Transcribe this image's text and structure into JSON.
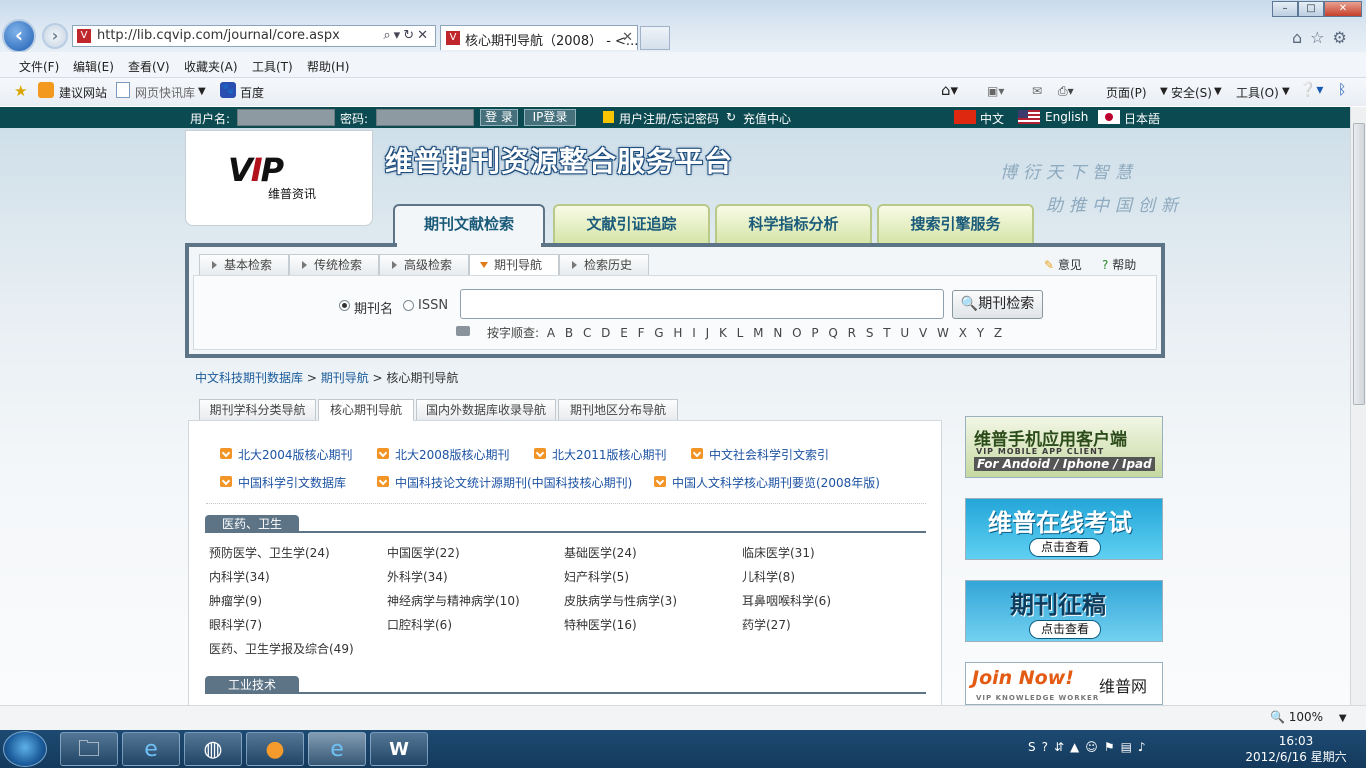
{
  "browser": {
    "url": "http://lib.cqvip.com/journal/core.aspx",
    "tab_title": "核心期刊导航（2008） - <...",
    "menu": [
      "文件(F)",
      "编辑(E)",
      "查看(V)",
      "收藏夹(A)",
      "工具(T)",
      "帮助(H)"
    ],
    "favorites": [
      "建议网站",
      "网页快讯库",
      "百度"
    ],
    "commands": [
      "页面(P)",
      "安全(S)",
      "工具(O)"
    ],
    "zoom": "100%"
  },
  "login": {
    "user_label": "用户名:",
    "pwd_label": "密码:",
    "login_btn": "登 录",
    "ip_btn": "IP登录",
    "register": "用户注册/忘记密码",
    "recharge": "充值中心",
    "lang_cn": "中文",
    "lang_en": "English",
    "lang_jp": "日本語"
  },
  "header": {
    "logo_sub": "维普资讯",
    "site_title": "维普期刊资源整合服务平台",
    "slogan1": "博衍天下智慧",
    "slogan2": "助推中国创新"
  },
  "main_tabs": [
    "期刊文献检索",
    "文献引证追踪",
    "科学指标分析",
    "搜索引擎服务"
  ],
  "search": {
    "subtabs": [
      "基本检索",
      "传统检索",
      "高级检索",
      "期刊导航",
      "检索历史"
    ],
    "opinion": "意见",
    "help": "帮助",
    "radio1": "期刊名",
    "radio2": "ISSN",
    "input_value": "",
    "button": "期刊检索",
    "letters_label": "按字顺查:",
    "letters": "A B C D E F G H I J K L M N O P Q R S T U V W X Y Z"
  },
  "breadcrumb": {
    "a": "中文科技期刊数据库",
    "sep": " > ",
    "b": "期刊导航",
    "cur": "核心期刊导航"
  },
  "list_tabs": [
    "期刊学科分类导航",
    "核心期刊导航",
    "国内外数据库收录导航",
    "期刊地区分布导航"
  ],
  "core_links": [
    "北大2004版核心期刊",
    "北大2008版核心期刊",
    "北大2011版核心期刊",
    "中文社会科学引文索引",
    "中国科学引文数据库",
    "中国科技论文统计源期刊(中国科技核心期刊)",
    "中国人文科学核心期刊要览(2008年版)"
  ],
  "sections": [
    {
      "title": "医药、卫生",
      "items": [
        "预防医学、卫生学(24)",
        "中国医学(22)",
        "基础医学(24)",
        "临床医学(31)",
        "内科学(34)",
        "外科学(34)",
        "妇产科学(5)",
        "儿科学(8)",
        "肿瘤学(9)",
        "神经病学与精神病学(10)",
        "皮肤病学与性病学(3)",
        "耳鼻咽喉科学(6)",
        "眼科学(7)",
        "口腔科学(6)",
        "特种医学(16)",
        "药学(27)",
        "医药、卫生学报及综合(49)"
      ]
    },
    {
      "title": "工业技术",
      "items": []
    }
  ],
  "banners": {
    "b1_title": "维普手机应用客户端",
    "b1_sub": "VIP MOBILE APP CLIENT",
    "b1_platforms": "For Andoid / Iphone / Ipad",
    "b2_title": "维普在线考试",
    "b2_btn": "点击查看",
    "b3_title": "期刊征稿",
    "b3_btn": "点击查看",
    "b4_title": "Join Now!",
    "b4_cn": "维普网",
    "b4_sub": "VIP KNOWLEDGE WORKER"
  },
  "taskbar": {
    "time": "16:03",
    "date": "2012/6/16 星期六"
  }
}
